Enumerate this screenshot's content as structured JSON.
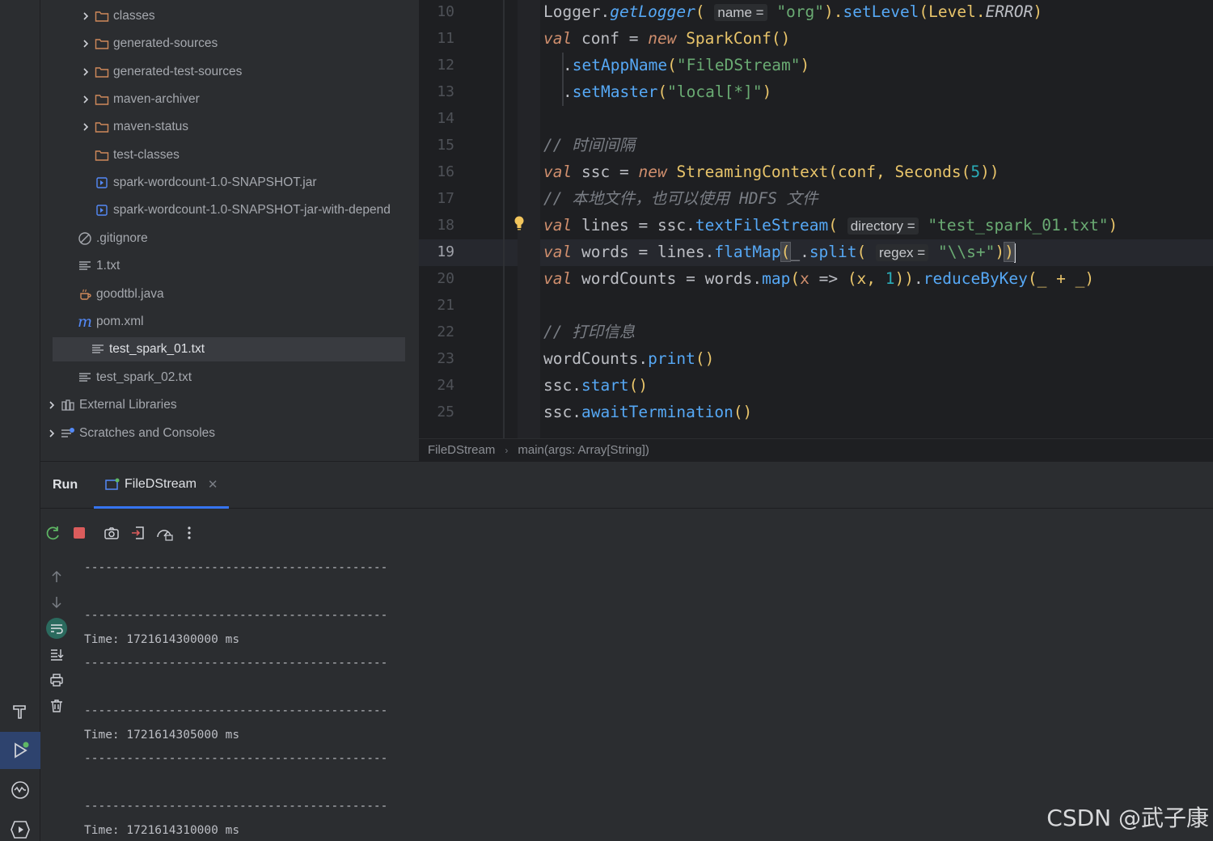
{
  "project_tree": [
    {
      "label": "classes",
      "type": "folder",
      "expandable": true
    },
    {
      "label": "generated-sources",
      "type": "folder",
      "expandable": true
    },
    {
      "label": "generated-test-sources",
      "type": "folder",
      "expandable": true
    },
    {
      "label": "maven-archiver",
      "type": "folder",
      "expandable": true
    },
    {
      "label": "maven-status",
      "type": "folder",
      "expandable": true
    },
    {
      "label": "test-classes",
      "type": "folder",
      "expandable": false
    },
    {
      "label": "spark-wordcount-1.0-SNAPSHOT.jar",
      "type": "jar",
      "expandable": false
    },
    {
      "label": "spark-wordcount-1.0-SNAPSHOT-jar-with-depend",
      "type": "jar",
      "expandable": false
    },
    {
      "label": ".gitignore",
      "type": "ignore",
      "expandable": false
    },
    {
      "label": "1.txt",
      "type": "text",
      "expandable": false
    },
    {
      "label": "goodtbl.java",
      "type": "java",
      "expandable": false
    },
    {
      "label": "pom.xml",
      "type": "maven",
      "expandable": false
    },
    {
      "label": "test_spark_01.txt",
      "type": "text",
      "expandable": false,
      "selected": true
    },
    {
      "label": "test_spark_02.txt",
      "type": "text",
      "expandable": false
    },
    {
      "label": "External Libraries",
      "type": "libraries",
      "expandable": true
    },
    {
      "label": "Scratches and Consoles",
      "type": "scratches",
      "expandable": true
    }
  ],
  "editor": {
    "line_numbers": [
      "10",
      "11",
      "12",
      "13",
      "14",
      "15",
      "16",
      "17",
      "18",
      "19",
      "20",
      "21",
      "22",
      "23",
      "24",
      "25"
    ],
    "current_line": "19",
    "tokens": {
      "l10": [
        "Logger",
        ".",
        "getLogger",
        "(",
        "name =",
        "\"org\"",
        ").",
        "setLevel",
        "(Level.",
        "ERROR",
        ")"
      ],
      "l11": [
        "val",
        "conf",
        "=",
        "new",
        "SparkConf",
        "()"
      ],
      "l12": [
        ".",
        "setAppName",
        "(",
        "\"FileDStream\"",
        ")"
      ],
      "l13": [
        ".",
        "setMaster",
        "(",
        "\"local[*]\"",
        ")"
      ],
      "l15": "// 时间间隔",
      "l16": [
        "val",
        "ssc",
        "=",
        "new",
        "StreamingContext",
        "(conf, ",
        "Seconds",
        "(",
        "5",
        "))"
      ],
      "l17": [
        "// 本地文件，也可以使用 ",
        "HDFS",
        " 文件"
      ],
      "l18": [
        "val",
        "lines",
        "=",
        "ssc.",
        "textFileStream",
        "(",
        "directory =",
        "\"test_spark_01.txt\"",
        ")"
      ],
      "l19": [
        "val",
        "words",
        "=",
        "lines.",
        "flatMap",
        "(",
        "_.",
        "split",
        "(",
        "regex =",
        "\"\\\\s+\"",
        ")",
        ")"
      ],
      "l20": [
        "val",
        "wordCounts",
        "=",
        "words.",
        "map",
        "(",
        "x",
        "=>",
        "(x, ",
        "1",
        "))",
        ".",
        "reduceByKey",
        "(_ + _)"
      ],
      "l22": "// 打印信息",
      "l23": [
        "wordCounts.",
        "print",
        "()"
      ],
      "l24": [
        "ssc.",
        "start",
        "()"
      ],
      "l25": [
        "ssc.",
        "awaitTermination",
        "()"
      ]
    }
  },
  "breadcrumb": {
    "items": [
      "FileDStream",
      "main(args: Array[String])"
    ]
  },
  "run_panel": {
    "label": "Run",
    "tab_label": "FileDStream",
    "console_lines": [
      "-------------------------------------------",
      "",
      "-------------------------------------------",
      "Time: 1721614300000 ms",
      "-------------------------------------------",
      "",
      "-------------------------------------------",
      "Time: 1721614305000 ms",
      "-------------------------------------------",
      "",
      "-------------------------------------------",
      "Time: 1721614310000 ms"
    ]
  },
  "watermark": "CSDN @武子康",
  "colors": {
    "keyword": "#cf8e6d",
    "function": "#56a8f5",
    "string": "#6aab73",
    "number": "#2aacb8",
    "comment": "#7a7e85",
    "accent": "#3574f0"
  }
}
